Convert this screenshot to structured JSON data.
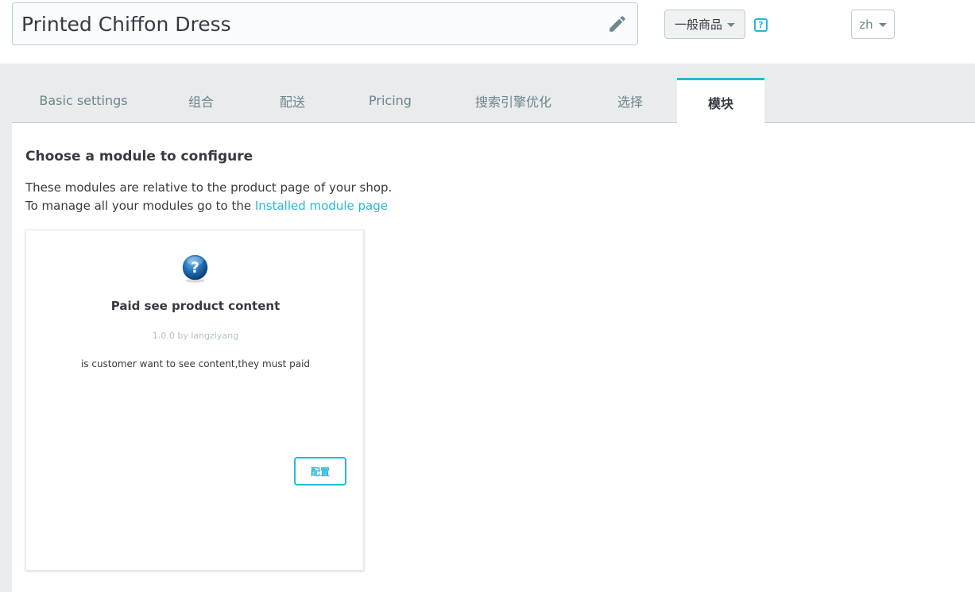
{
  "header": {
    "product_name": "Printed Chiffon Dress",
    "product_type": "一般商品",
    "help_symbol": "?",
    "language": "zh"
  },
  "tabs": [
    {
      "label": "Basic settings",
      "active": false
    },
    {
      "label": "组合",
      "active": false
    },
    {
      "label": "配送",
      "active": false
    },
    {
      "label": "Pricing",
      "active": false
    },
    {
      "label": "搜索引擎优化",
      "active": false
    },
    {
      "label": "选择",
      "active": false
    },
    {
      "label": "模块",
      "active": true
    }
  ],
  "modules_section": {
    "title": "Choose a module to configure",
    "description_line1": "These modules are relative to the product page of your shop.",
    "description_line2_prefix": "To manage all your modules go to the",
    "link_text": "Installed module page"
  },
  "module_card": {
    "icon": "question-globe-icon",
    "name": "Paid see product content",
    "version_author": "1.0.0 by langziyang",
    "description": "is customer want to see content,they must paid",
    "configure_label": "配置"
  },
  "colors": {
    "accent": "#25b9d7",
    "text": "#363a41",
    "muted": "#6c868e",
    "background_gray": "#eaebec"
  }
}
